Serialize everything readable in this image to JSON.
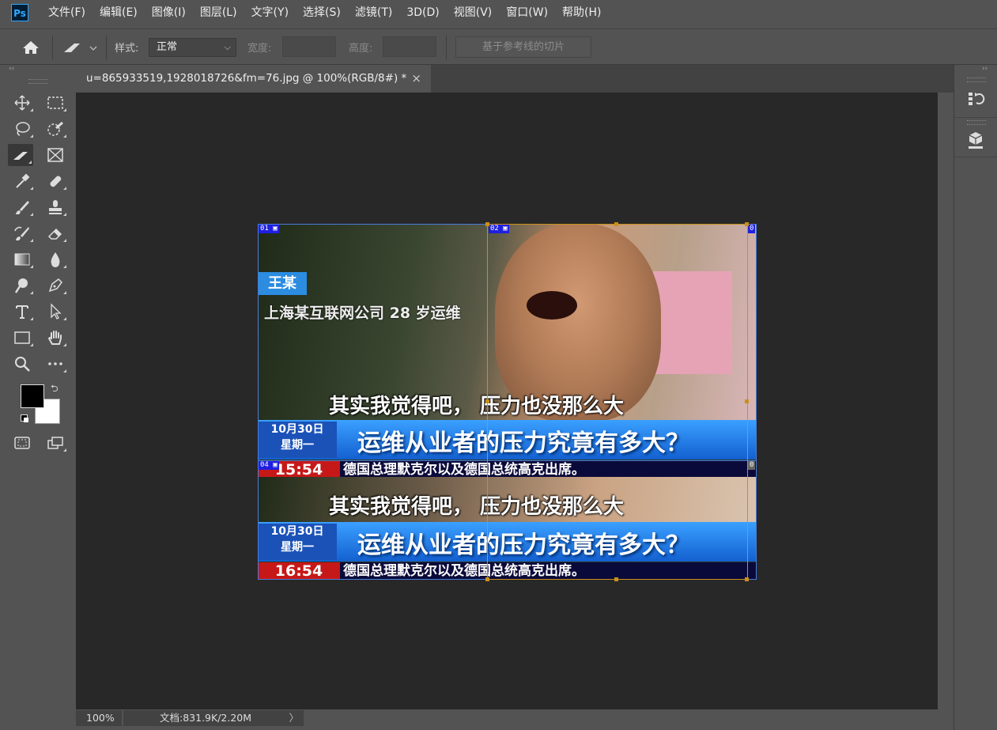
{
  "app": {
    "logo": "Ps"
  },
  "menu": [
    "文件(F)",
    "编辑(E)",
    "图像(I)",
    "图层(L)",
    "文字(Y)",
    "选择(S)",
    "滤镜(T)",
    "3D(D)",
    "视图(V)",
    "窗口(W)",
    "帮助(H)"
  ],
  "options": {
    "style_label": "样式:",
    "style_value": "正常",
    "width_label": "宽度:",
    "height_label": "高度:",
    "slice_guides_button": "基于参考线的切片"
  },
  "document": {
    "tab_title": "u=865933519,1928018726&fm=76.jpg @ 100%(RGB/8#) *",
    "close_glyph": "×"
  },
  "image_content": {
    "name_badge": "王某",
    "subtitle": "上海某互联网公司 28 岁运维",
    "caption": "其实我觉得吧，  压力也没那么大",
    "date_line1": "10月30日",
    "date_line2": "星期一",
    "headline": "运维从业者的压力究竟有多大？",
    "clock": "16:54",
    "clock_partial": "15:54",
    "news_text": "德国总理默克尔以及德国总统高克出席。"
  },
  "slices": {
    "s1": "01",
    "s2": "02",
    "s3": "0",
    "s4": "04",
    "s5": "0"
  },
  "status": {
    "zoom": "100%",
    "doc_info": "文档:831.9K/2.20M",
    "arrow": "〉"
  },
  "colors": {
    "ui_bg": "#535353",
    "canvas_bg": "#282828",
    "slice_user": "#c8901a",
    "slice_auto": "#4a7bd8",
    "slice_label": "#1f1fe0"
  }
}
